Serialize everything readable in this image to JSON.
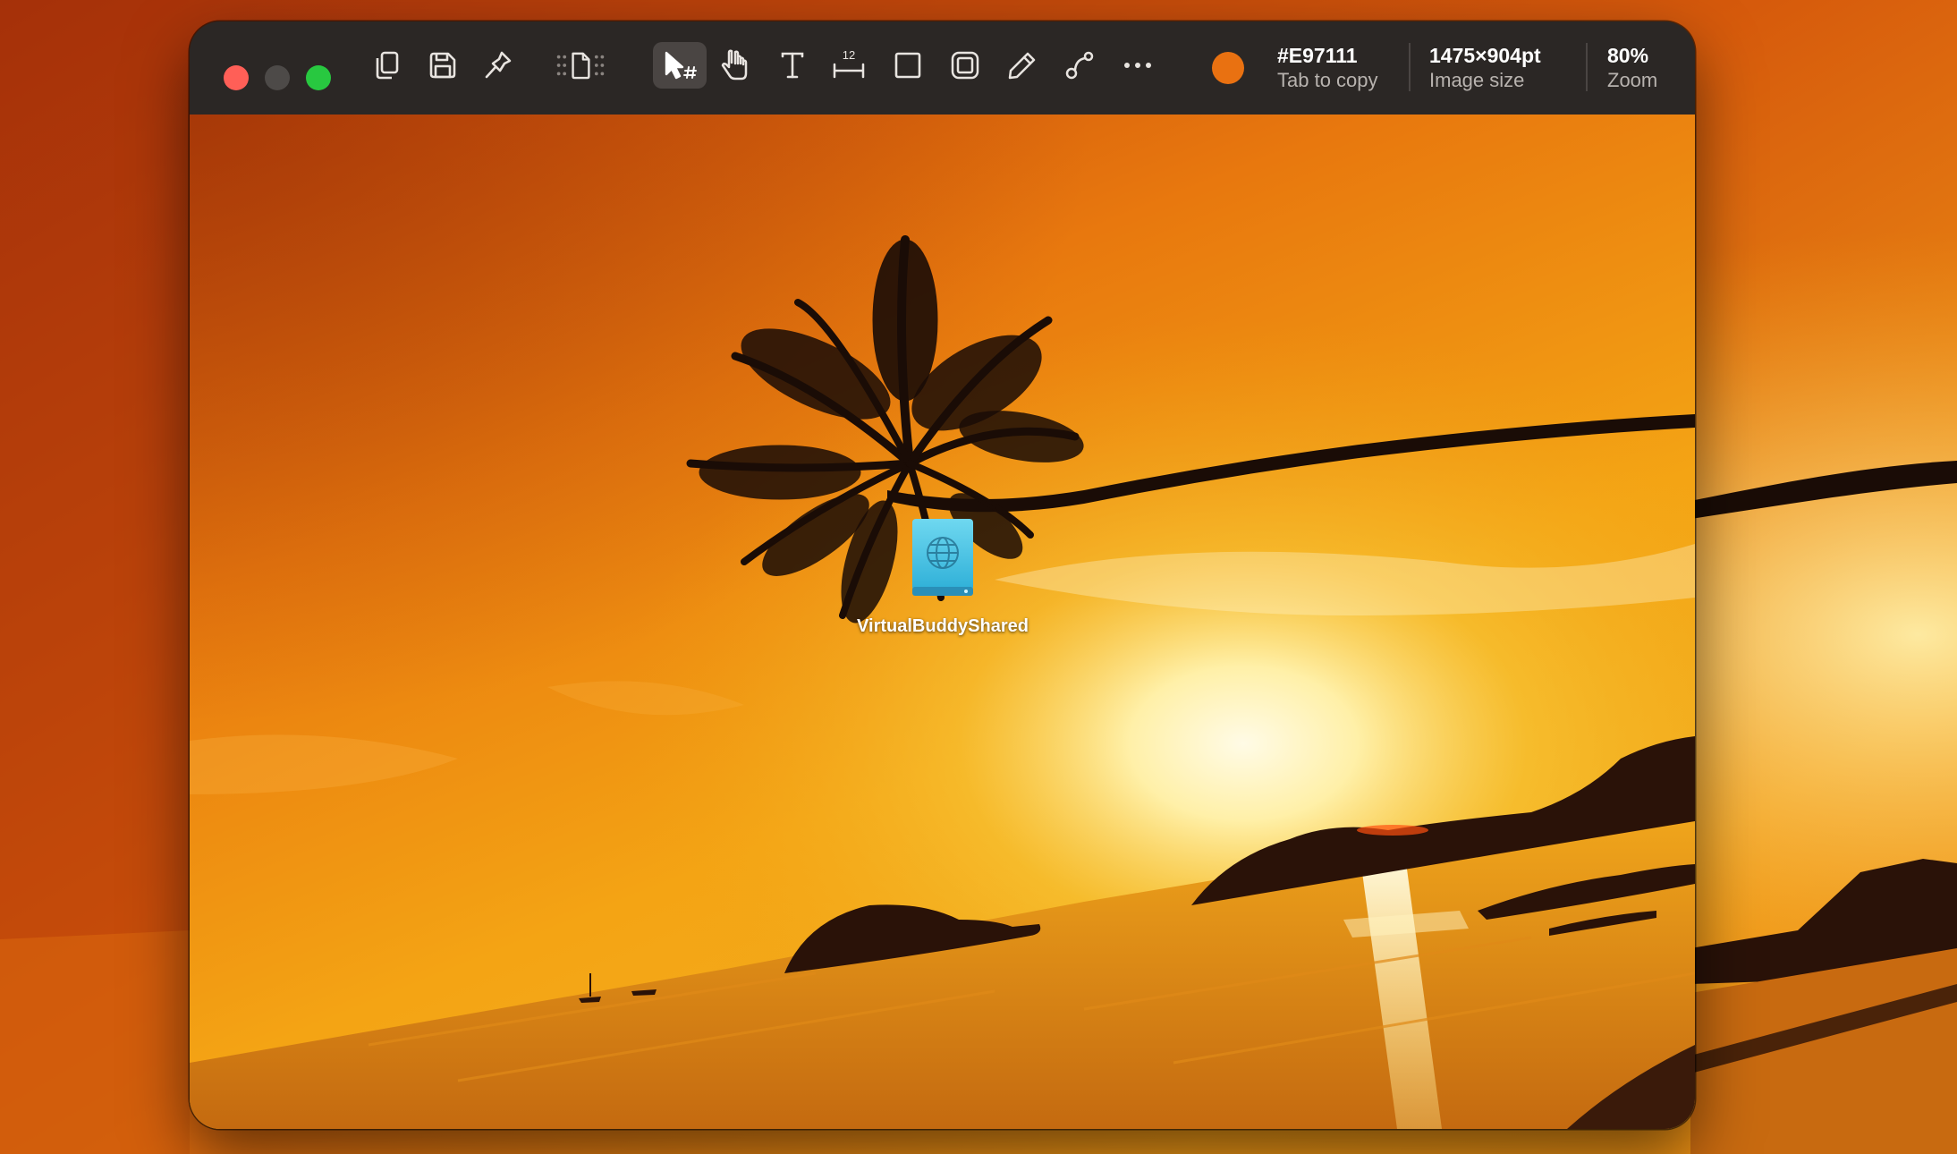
{
  "toolbar": {
    "traffic_lights": [
      "close",
      "minimize",
      "zoom"
    ],
    "actions": [
      {
        "icon": "copy-icon"
      },
      {
        "icon": "save-icon"
      },
      {
        "icon": "pin-icon"
      },
      {
        "icon": "page-resize-icon"
      }
    ],
    "tools": [
      {
        "icon": "select-tool-icon",
        "active": true
      },
      {
        "icon": "hand-tool-icon"
      },
      {
        "icon": "text-tool-icon"
      },
      {
        "icon": "measure-tool-icon",
        "label": "12"
      },
      {
        "icon": "rectangle-tool-icon"
      },
      {
        "icon": "frame-tool-icon"
      },
      {
        "icon": "pencil-tool-icon"
      },
      {
        "icon": "curve-tool-icon"
      },
      {
        "icon": "more-icon"
      }
    ],
    "color": {
      "hex": "#E97111",
      "hint": "Tab to copy",
      "swatch": "#e97111"
    },
    "image_size": {
      "value": "1475×904pt",
      "label": "Image size"
    },
    "zoom": {
      "value": "80%",
      "label": "Zoom"
    }
  },
  "canvas": {
    "desktop_icon": {
      "label": "VirtualBuddyShared",
      "icon": "network-volume-icon"
    }
  },
  "colors": {
    "sky_top": "#c8480a",
    "sky_mid": "#f08c10",
    "sun": "#fff4c8",
    "sea": "#d87a10",
    "silhouette": "#1a0c06",
    "toolbar_bg": "#2b2725"
  }
}
